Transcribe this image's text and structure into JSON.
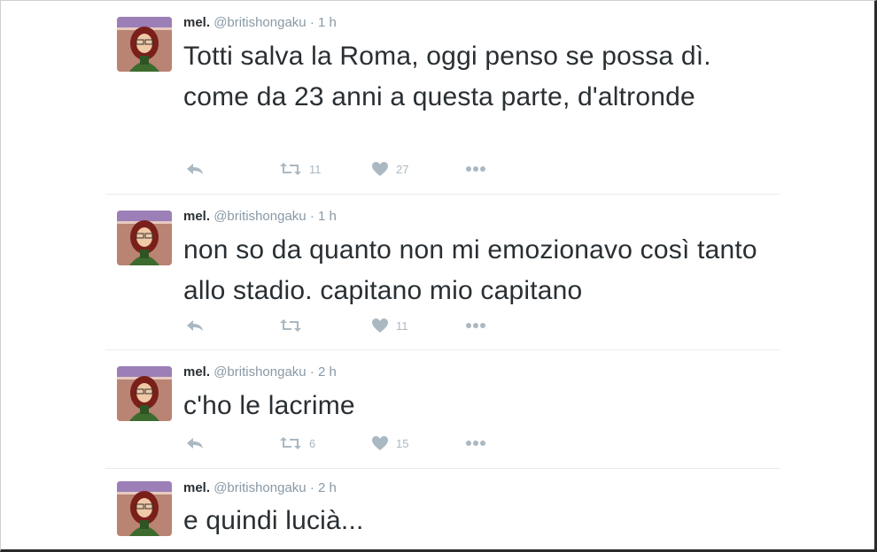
{
  "colors": {
    "text": "#292f33",
    "muted": "#8899a6",
    "icon": "#aab8c2",
    "divider": "#e6ecf0"
  },
  "tweets": [
    {
      "name": "mel.",
      "handle": "@britishongaku",
      "sep": "·",
      "time": "1 h",
      "text": "Totti salva la Roma, oggi penso se possa dì. come da 23 anni a questa parte, d'altronde",
      "retweets": "11",
      "likes": "27"
    },
    {
      "name": "mel.",
      "handle": "@britishongaku",
      "sep": "·",
      "time": "1 h",
      "text": "non so da quanto non mi emozionavo così tanto allo stadio. capitano mio capitano",
      "retweets": "",
      "likes": "11"
    },
    {
      "name": "mel.",
      "handle": "@britishongaku",
      "sep": "·",
      "time": "2 h",
      "text": "c'ho le lacrime",
      "retweets": "6",
      "likes": "15"
    },
    {
      "name": "mel.",
      "handle": "@britishongaku",
      "sep": "·",
      "time": "2 h",
      "text": "e quindi lucià..."
    }
  ],
  "icons": {
    "reply": "reply-icon",
    "retweet": "retweet-icon",
    "like": "heart-icon",
    "more": "more-icon"
  }
}
